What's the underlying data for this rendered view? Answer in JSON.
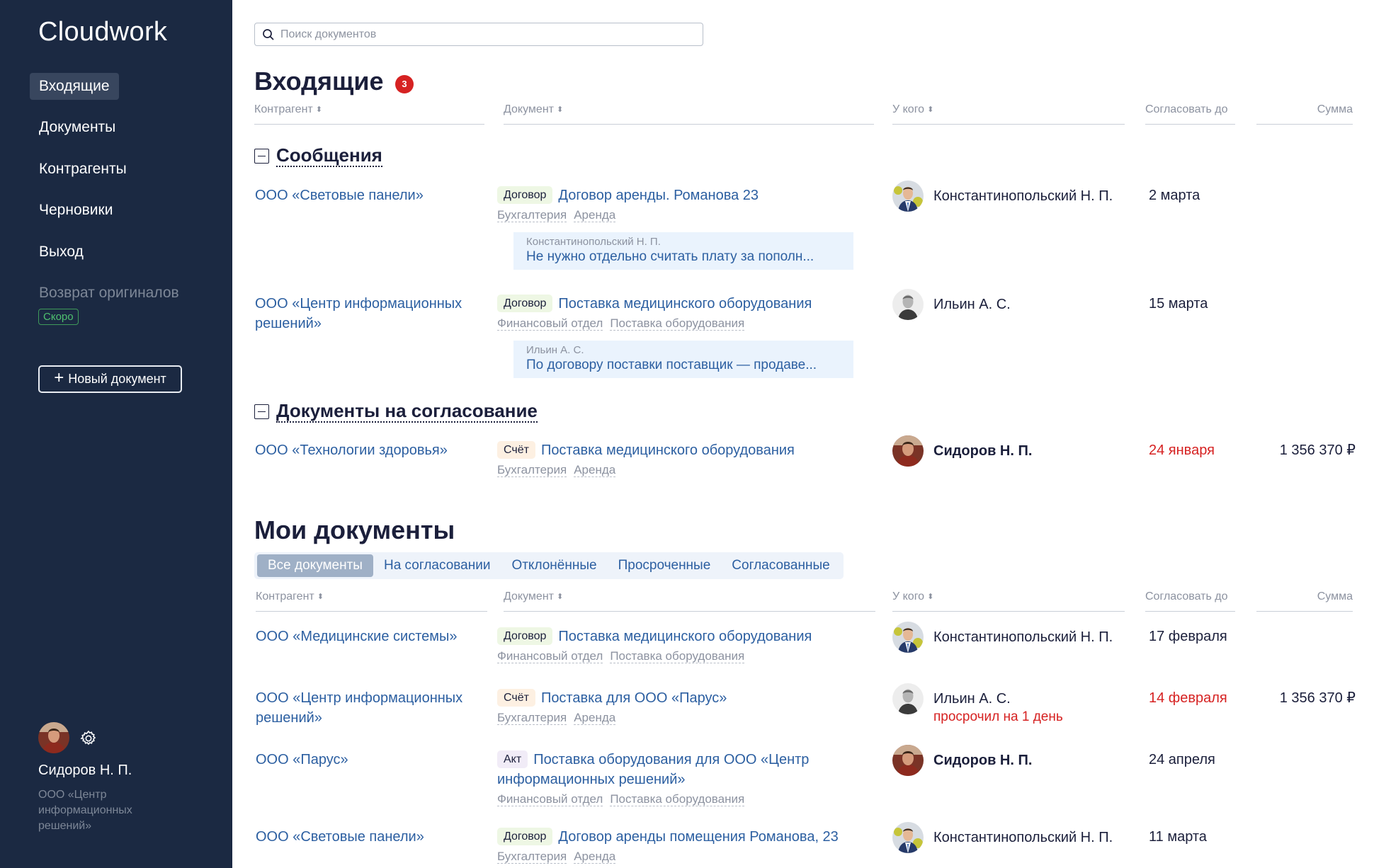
{
  "app": {
    "title": "Cloudwork"
  },
  "sidebar": {
    "items": [
      {
        "label": "Входящие",
        "active": true
      },
      {
        "label": "Документы"
      },
      {
        "label": "Контрагенты"
      },
      {
        "label": "Черновики"
      },
      {
        "label": "Выход"
      },
      {
        "label": "Возврат оригиналов",
        "disabled": true
      }
    ],
    "soon_badge": "Скоро",
    "new_doc_label": "Новый документ",
    "user": {
      "name": "Сидоров Н. П.",
      "org": "ООО «Центр информационных решений»"
    }
  },
  "search": {
    "placeholder": "Поиск документов",
    "value": ""
  },
  "inbox": {
    "title": "Входящие",
    "count": "3",
    "columns": {
      "counterparty": "Контрагент",
      "document": "Документ",
      "who": "У кого",
      "deadline": "Согласовать до",
      "sum": "Сумма"
    },
    "sections": [
      {
        "title": "Сообщения"
      },
      {
        "title": "Документы на согласование"
      }
    ],
    "rows": [
      {
        "counterparty": "ООО «Световые панели»",
        "type": "Договор",
        "doc": "Договор аренды. Романова 23",
        "tags": [
          "Бухгалтерия",
          "Аренда"
        ],
        "msg_author": "Константинопольский Н. П.",
        "msg_text": "Не нужно отдельно считать плату за пополн...",
        "who": "Константинопольский Н. П.",
        "deadline": "2 марта",
        "sum": ""
      },
      {
        "counterparty": "ООО «Центр информационных решений»",
        "type": "Договор",
        "doc": "Поставка медицинского оборудования",
        "tags": [
          "Финансовый отдел",
          "Поставка оборудования"
        ],
        "msg_author": "Ильин А. С.",
        "msg_text": "По договору поставки поставщик — продаве...",
        "who": "Ильин А. С.",
        "deadline": "15 марта",
        "sum": ""
      },
      {
        "counterparty": "ООО «Технологии здоровья»",
        "type": "Счёт",
        "doc": "Поставка медицинского оборудования",
        "tags": [
          "Бухгалтерия",
          "Аренда"
        ],
        "who": "Сидоров Н. П.",
        "deadline": "24 января",
        "sum": "1 356 370 ₽"
      }
    ]
  },
  "my_docs": {
    "title": "Мои документы",
    "tabs": [
      "Все документы",
      "На согласовании",
      "Отклонённые",
      "Просроченные",
      "Согласованные"
    ],
    "columns": {
      "counterparty": "Контрагент",
      "document": "Документ",
      "who": "У кого",
      "deadline": "Согласовать до",
      "sum": "Сумма"
    },
    "rows": [
      {
        "counterparty": "ООО «Медицинские системы»",
        "type": "Договор",
        "doc": "Поставка медицинского оборудования",
        "tags": [
          "Финансовый отдел",
          "Поставка оборудования"
        ],
        "who": "Константинопольский Н. П.",
        "deadline": "17 февраля",
        "sum": ""
      },
      {
        "counterparty": "ООО «Центр информационных решений»",
        "type": "Счёт",
        "doc": "Поставка для ООО «Парус»",
        "tags": [
          "Бухгалтерия",
          "Аренда"
        ],
        "who": "Ильин А. С.",
        "who_note": "просрочил на 1 день",
        "deadline": "14 февраля",
        "sum": "1 356 370 ₽"
      },
      {
        "counterparty": "ООО «Парус»",
        "type": "Акт",
        "doc": "Поставка оборудования для ООО «Центр информационных решений»",
        "tags": [
          "Финансовый отдел",
          "Поставка оборудования"
        ],
        "who": "Сидоров Н. П.",
        "deadline": "24 апреля",
        "sum": ""
      },
      {
        "counterparty": "ООО «Световые панели»",
        "type": "Договор",
        "doc": "Договор аренды помещения Романова, 23",
        "tags": [
          "Бухгалтерия",
          "Аренда"
        ],
        "who": "Константинопольский Н. П.",
        "deadline": "11 марта",
        "sum": ""
      }
    ]
  },
  "colors": {
    "sidebar_bg": "#1b2942",
    "link": "#2c5fa1",
    "danger": "#d62222",
    "active_tab": "#9fb0c6"
  },
  "icons": [
    "search-icon",
    "plus-icon",
    "gear-icon",
    "collapse-icon",
    "sort-icon"
  ]
}
